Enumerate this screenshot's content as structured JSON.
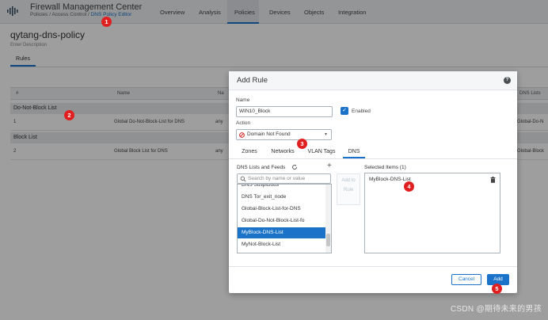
{
  "header": {
    "app_title": "Firewall Management Center",
    "breadcrumb_prefix": "Policies / Access Control / ",
    "breadcrumb_current": "DNS Policy Editor",
    "nav": [
      "Overview",
      "Analysis",
      "Policies",
      "Devices",
      "Objects",
      "Integration"
    ],
    "active_nav": "Policies"
  },
  "page": {
    "title": "qytang-dns-policy",
    "description_placeholder": "Enter Description",
    "tab_rules": "Rules"
  },
  "table": {
    "columns": [
      "#",
      "Name",
      "Na",
      "DNS Lists"
    ],
    "sections": [
      {
        "label": "Do-Not-Block List",
        "rows": [
          {
            "num": "1",
            "name": "Global Do-Not-Block-List for DNS",
            "col3": "any",
            "dns": "Global-Do-N"
          }
        ]
      },
      {
        "label": "Block List",
        "rows": [
          {
            "num": "2",
            "name": "Global Block List for DNS",
            "col3": "any",
            "dns": "Global-Block"
          }
        ]
      }
    ]
  },
  "modal": {
    "title": "Add Rule",
    "name_label": "Name",
    "name_value": "WIN10_Block",
    "enabled_label": "Enabled",
    "enabled": true,
    "action_label": "Action",
    "action_value": "Domain Not Found",
    "tabs": [
      "Zones",
      "Networks",
      "VLAN Tags",
      "DNS"
    ],
    "active_tab": "DNS",
    "lists_header": "DNS Lists and Feeds",
    "search_placeholder": "Search by name or value",
    "list_items": [
      "DNS Suspicious",
      "DNS Tor_exit_node",
      "Global-Block-List-for-DNS",
      "Global-Do-Not-Block-List-fo",
      "MyBlock-DNS-List",
      "MyNot-Block-List"
    ],
    "selected_list_item": "MyBlock-DNS-List",
    "add_middle_label": "Add to Rule",
    "selected_header": "Selected Items (1)",
    "selected_items": [
      "MyBlock-DNS-List"
    ],
    "cancel_label": "Cancel",
    "add_label": "Add"
  },
  "annotations": [
    "1",
    "2",
    "3",
    "4",
    "5"
  ],
  "watermark": "CSDN @期待未来的男孩",
  "colors": {
    "accent": "#1a73c9",
    "badge": "#e02020"
  }
}
